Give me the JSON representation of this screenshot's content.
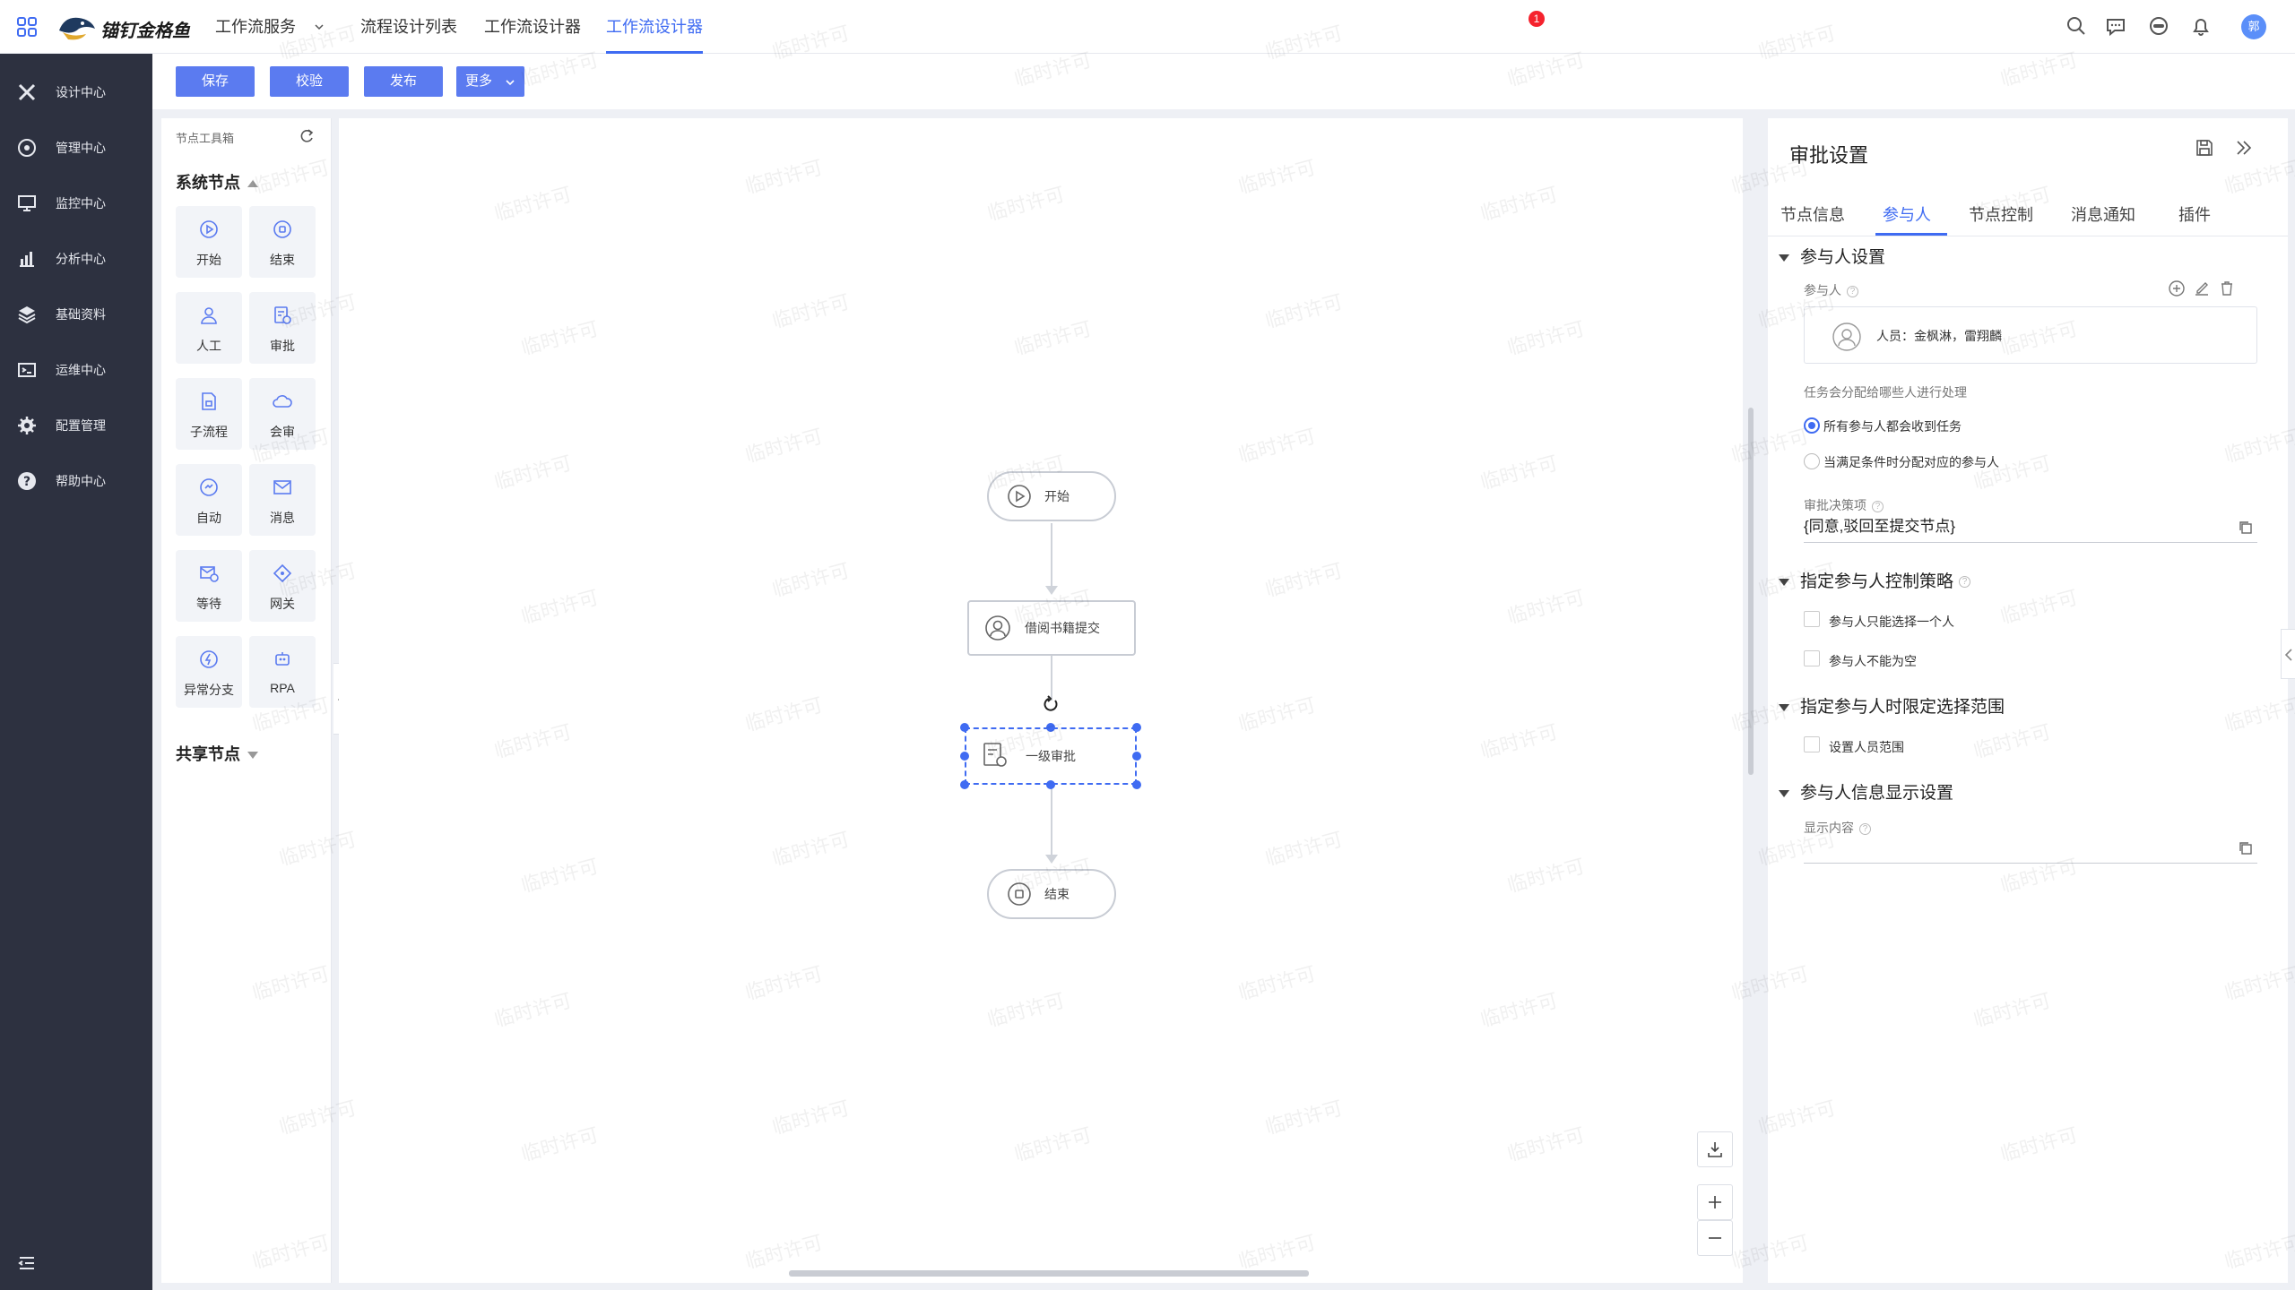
{
  "topnav": {
    "logo_text": "锚钉金格鱼",
    "service": "工作流服务",
    "tabs": [
      "流程设计列表",
      "工作流设计器",
      "工作流设计器"
    ],
    "notification_count": "1",
    "user_initial": "郭"
  },
  "sidebar": {
    "items": [
      {
        "label": "设计中心",
        "icon": "design-icon"
      },
      {
        "label": "管理中心",
        "icon": "manage-icon"
      },
      {
        "label": "监控中心",
        "icon": "monitor-icon"
      },
      {
        "label": "分析中心",
        "icon": "analysis-icon"
      },
      {
        "label": "基础资料",
        "icon": "layers-icon"
      },
      {
        "label": "运维中心",
        "icon": "ops-icon"
      },
      {
        "label": "配置管理",
        "icon": "gear-icon"
      },
      {
        "label": "帮助中心",
        "icon": "help-icon"
      }
    ]
  },
  "toolbar": {
    "save": "保存",
    "validate": "校验",
    "publish": "发布",
    "more": "更多"
  },
  "toolbox": {
    "title": "节点工具箱",
    "system_section": "系统节点",
    "shared_section": "共享节点",
    "nodes": [
      "开始",
      "结束",
      "人工",
      "审批",
      "子流程",
      "会审",
      "自动",
      "消息",
      "等待",
      "网关",
      "异常分支",
      "RPA"
    ]
  },
  "canvas": {
    "nodes": {
      "start": "开始",
      "submit": "借阅书籍提交",
      "approve": "一级审批",
      "end": "结束"
    }
  },
  "panel": {
    "title": "审批设置",
    "tabs": [
      "节点信息",
      "参与人",
      "节点控制",
      "消息通知",
      "插件"
    ],
    "active_tab": "参与人",
    "participant_section": "参与人设置",
    "participant_label": "参与人",
    "participant_value": "人员：金枫淋，雷翔麟",
    "assign_label": "任务会分配给哪些人进行处理",
    "radio_all": "所有参与人都会收到任务",
    "radio_cond": "当满足条件时分配对应的参与人",
    "decision_label": "审批决策项",
    "decision_value": "{同意,驳回至提交节点}",
    "strategy_section": "指定参与人控制策略",
    "chk_one": "参与人只能选择一个人",
    "chk_nonempty": "参与人不能为空",
    "range_section": "指定参与人时限定选择范围",
    "chk_range": "设置人员范围",
    "display_section": "参与人信息显示设置",
    "display_label": "显示内容",
    "display_value": ""
  },
  "watermark": "临时许可"
}
